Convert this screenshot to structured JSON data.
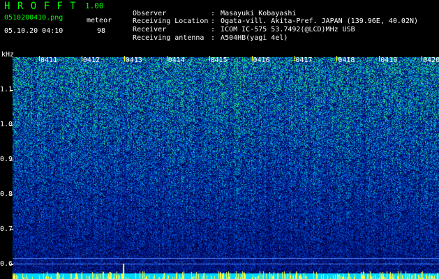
{
  "header": {
    "title": "H R O F F T",
    "version": "1.00",
    "filename": "0510200410.png",
    "mode": "meteor",
    "datetime": "05.10.20 04:10",
    "count": "98"
  },
  "info": [
    {
      "label": "Observer",
      "value": "Masayuki Kobayashi"
    },
    {
      "label": "Receiving Location",
      "value": "Ogata-vill. Akita-Pref. JAPAN (139.96E, 40.02N)"
    },
    {
      "label": "Receiver",
      "value": "ICOM IC-575 53.7492(@LCD)MHz USB"
    },
    {
      "label": "Receiving antenna",
      "value": "A504HB(yagi 4el)"
    }
  ],
  "separator": ":",
  "spectrogram": {
    "unit_label": "kHz",
    "y_ticks": [
      "1.1",
      "1.0",
      "0.9",
      "0.8",
      "0.7",
      "0.6"
    ],
    "y_tick_values": [
      1.1,
      1.0,
      0.9,
      0.8,
      0.7,
      0.6
    ],
    "time_labels": [
      "0411",
      "0412",
      "0413",
      "0414",
      "0415",
      "0416",
      "0417",
      "0418",
      "0419",
      "0420"
    ],
    "colors": {
      "background": "#000000",
      "text": "#ffffff",
      "accent": "#ffff00",
      "title": "#00ff00"
    }
  }
}
